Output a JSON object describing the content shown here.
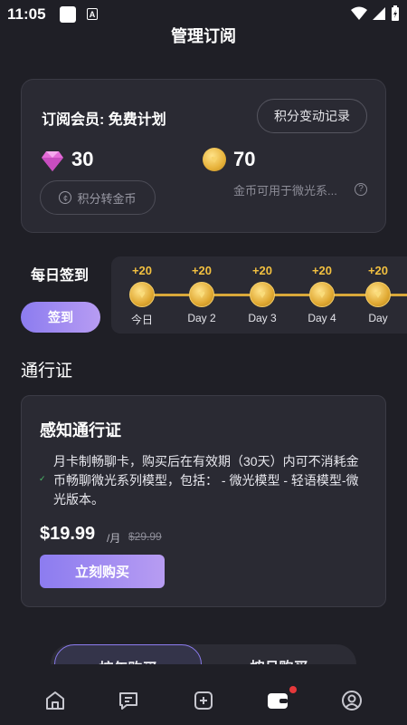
{
  "status_bar": {
    "time": "11:05",
    "notification_glyph": "A"
  },
  "header": {
    "title": "管理订阅"
  },
  "subscription": {
    "plan_label": "订阅会员: 免费计划",
    "history_button": "积分变动记录",
    "points_value": "30",
    "coins_value": "70",
    "convert_button": "积分转金币",
    "convert_icon_glyph": "¢",
    "coin_note": "金币可用于微光系...",
    "help_glyph": "?"
  },
  "checkin": {
    "title": "每日签到",
    "button": "签到",
    "days": [
      {
        "reward": "+20",
        "label": "今日"
      },
      {
        "reward": "+20",
        "label": "Day 2"
      },
      {
        "reward": "+20",
        "label": "Day 3"
      },
      {
        "reward": "+20",
        "label": "Day 4"
      },
      {
        "reward": "+20",
        "label": "Day"
      }
    ]
  },
  "pass": {
    "section_title": "通行证",
    "name": "感知通行证",
    "check_glyph": "✓",
    "description": "月卡制畅聊卡，购买后在有效期（30天）内可不消耗金币畅聊微光系列模型，包括： - 微光模型 - 轻语模型-微光版本。",
    "price": "$19.99",
    "period": "/月",
    "old_price": "$29.99",
    "buy_button": "立刻购买"
  },
  "purchase_tabs": {
    "yearly": "按年购买",
    "monthly": "按月购买"
  },
  "colors": {
    "accent": "#8c7cf0",
    "gold": "#f2c040",
    "background": "#1f1f26",
    "card": "#2a2a33"
  }
}
